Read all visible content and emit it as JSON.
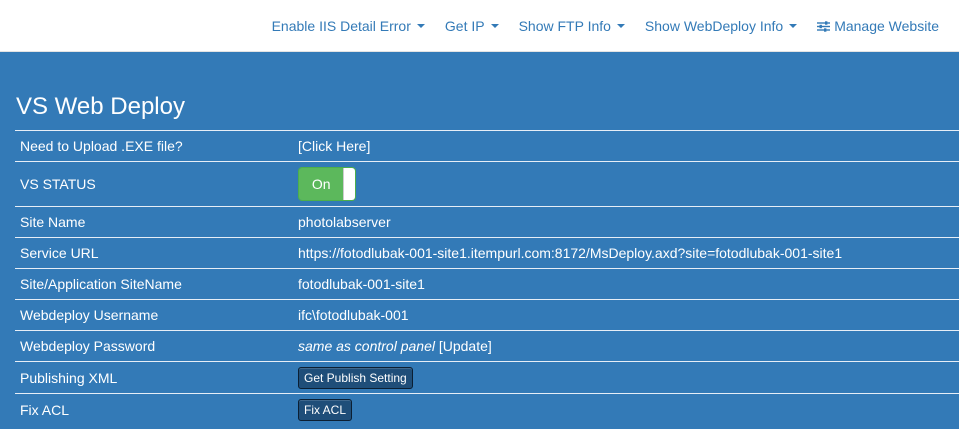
{
  "nav": {
    "items": [
      {
        "label": "Enable IIS Detail Error",
        "icon": "caret-down-icon"
      },
      {
        "label": "Get IP",
        "icon": "caret-down-icon"
      },
      {
        "label": "Show FTP Info",
        "icon": "caret-down-icon"
      },
      {
        "label": "Show WebDeploy Info",
        "icon": "caret-down-icon"
      }
    ],
    "manage": {
      "label": "Manage Website",
      "icon": "sliders-icon"
    }
  },
  "panel": {
    "title": "VS Web Deploy",
    "rows": [
      {
        "label": "Need to Upload .EXE file?",
        "value": "[Click Here]"
      },
      {
        "label": "VS STATUS",
        "toggle": "On"
      },
      {
        "label": "Site Name",
        "value": "photolabserver"
      },
      {
        "label": "Service URL",
        "value": "https://fotodlubak-001-site1.itempurl.com:8172/MsDeploy.axd?site=fotodlubak-001-site1"
      },
      {
        "label": "Site/Application SiteName",
        "value": "fotodlubak-001-site1"
      },
      {
        "label": "Webdeploy Username",
        "value": "ifc\\fotodlubak-001"
      },
      {
        "label": "Webdeploy Password",
        "value_italic": "same as control panel",
        "value_link": "[Update]"
      },
      {
        "label": "Publishing XML",
        "button": "Get Publish Setting"
      },
      {
        "label": "Fix ACL",
        "button": "Fix ACL"
      }
    ]
  },
  "colors": {
    "panel_bg": "#337ab7",
    "nav_link": "#337ab7",
    "toggle_on": "#5cb85c",
    "button_bg": "#1f4e79"
  }
}
